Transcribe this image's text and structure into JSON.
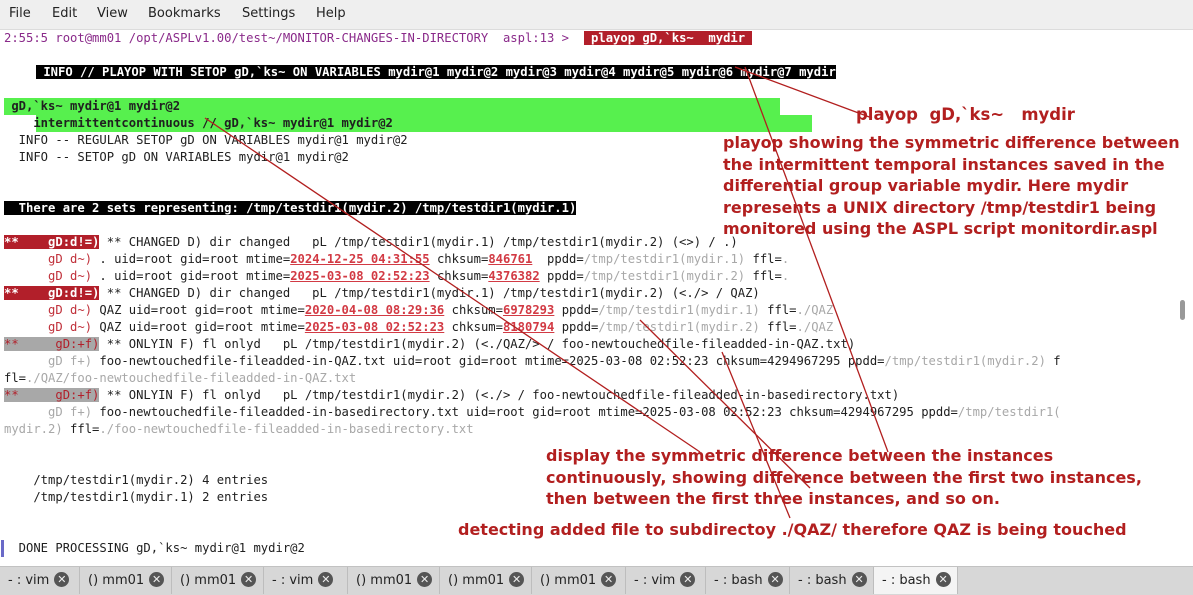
{
  "menu": [
    "File",
    "Edit",
    "View",
    "Bookmarks",
    "Settings",
    "Help"
  ],
  "terminal": {
    "prompt": "2:55:5 root@mm01 /opt/ASPLv1.00/test~/MONITOR-CHANGES-IN-DIRECTORY  aspl:13 >",
    "command": " playop gD,`ks~  mydir ",
    "info_header": " INFO // PLAYOP WITH SETOP gD,`ks~ ON VARIABLES mydir@1 mydir@2 mydir@3 mydir@4 mydir@5 mydir@6 mydir@7 mydir",
    "green1": " gD,`ks~ mydir@1 mydir@2",
    "green2": "    intermittentcontinuous // gD,`ks~ mydir@1 mydir@2",
    "info_regular": "  INFO -- REGULAR SETOP gD ON VARIABLES mydir@1 mydir@2",
    "info_setop": "  INFO -- SETOP gD ON VARIABLES mydir@1 mydir@2",
    "sets_header": "  There are 2 sets representing: /tmp/testdir1(mydir.2) /tmp/testdir1(mydir.1)",
    "tag_changed": "**    gD:d!=)",
    "tag_onlyin": "**     gD:+f)",
    "tag_gdm": "gD d~)",
    "tag_gdf": "gD f+)",
    "changed1": " ** CHANGED D) dir changed   pL /tmp/testdir1(mydir.1) /tmp/testdir1(mydir.2) (<>) / .)",
    "d1a": {
      "pre": " . uid=root gid=root mtime=",
      "mtime": "2024-12-25 04:31:55",
      "mid": " chksum=",
      "chk": "846761",
      "pp": "  ppdd=",
      "ppdd": "/tmp/testdir1(mydir.1)",
      "ffl": " ffl=",
      "fflv": "."
    },
    "d1b": {
      "pre": " . uid=root gid=root mtime=",
      "mtime": "2025-03-08 02:52:23",
      "mid": " chksum=",
      "chk": "4376382",
      "pp": " ppdd=",
      "ppdd": "/tmp/testdir1(mydir.2)",
      "ffl": " ffl=",
      "fflv": "."
    },
    "changed2": " ** CHANGED D) dir changed   pL /tmp/testdir1(mydir.1) /tmp/testdir1(mydir.2) (<./> / QAZ)",
    "d2a": {
      "pre": " QAZ uid=root gid=root mtime=",
      "mtime": "2020-04-08 08:29:36",
      "mid": " chksum=",
      "chk": "6978293",
      "pp": " ppdd=",
      "ppdd": "/tmp/testdir1(mydir.1)",
      "ffl": " ffl=",
      "fflv": "./QAZ"
    },
    "d2b": {
      "pre": " QAZ uid=root gid=root mtime=",
      "mtime": "2025-03-08 02:52:23",
      "mid": " chksum=",
      "chk": "8180794",
      "pp": " ppdd=",
      "ppdd": "/tmp/testdir1(mydir.2)",
      "ffl": " ffl=",
      "fflv": "./QAZ"
    },
    "onlyin1": " ** ONLYIN F) fl onlyd   pL /tmp/testdir1(mydir.2) (<./QAZ/> / foo-newtouchedfile-fileadded-in-QAZ.txt)",
    "f1": {
      "pre": " foo-newtouchedfile-fileadded-in-QAZ.txt uid=root gid=root mtime=2025-03-08 02:52:23 chksum=4294967295 ppdd=",
      "ppdd": "/tmp/testdir1(mydir.2)",
      "tail": " f"
    },
    "f1_wrap": {
      "pre": "fl=",
      "val": "./QAZ/foo-newtouchedfile-fileadded-in-QAZ.txt"
    },
    "onlyin2": " ** ONLYIN F) fl onlyd   pL /tmp/testdir1(mydir.2) (<./> / foo-newtouchedfile-fileadded-in-basedirectory.txt)",
    "f2": {
      "pre": " foo-newtouchedfile-fileadded-in-basedirectory.txt uid=root gid=root mtime=2025-03-08 02:52:23 chksum=4294967295 ppdd=",
      "ppdd": "/tmp/testdir1("
    },
    "f2_wrap": {
      "a": "mydir.2)",
      "b": " ffl=",
      "c": "./foo-newtouchedfile-fileadded-in-basedirectory.txt"
    },
    "entries1": "    /tmp/testdir1(mydir.2) 4 entries",
    "entries2": "    /tmp/testdir1(mydir.1) 2 entries",
    "done": "  DONE PROCESSING gD,`ks~ mydir@1 mydir@2"
  },
  "annotations": {
    "title": "playop  gD,`ks~   mydir",
    "desc": "playop showing the symmetric difference between\nthe intermittent temporal instances saved in the\ndifferential group variable mydir. Here mydir\nrepresents a UNIX directory /tmp/testdir1 being\nmonitored using the ASPL script monitordir.aspl",
    "continuous": "display the symmetric difference between the instances\ncontinuously, showing difference between the first two instances,\nthen between the first three instances, and so on.",
    "detect": "detecting added file to subdirectoy ./QAZ/ therefore QAZ is being touched"
  },
  "tabs": [
    "- : vim",
    "() mm01",
    "() mm01",
    "- : vim",
    "() mm01",
    "() mm01",
    "() mm01",
    "- : vim",
    "- : bash",
    "- : bash",
    "- : bash"
  ],
  "colors": {
    "accent_red": "#b21f1f",
    "green_highlight": "#57f04e",
    "prompt_purple": "#8a2a8a"
  }
}
